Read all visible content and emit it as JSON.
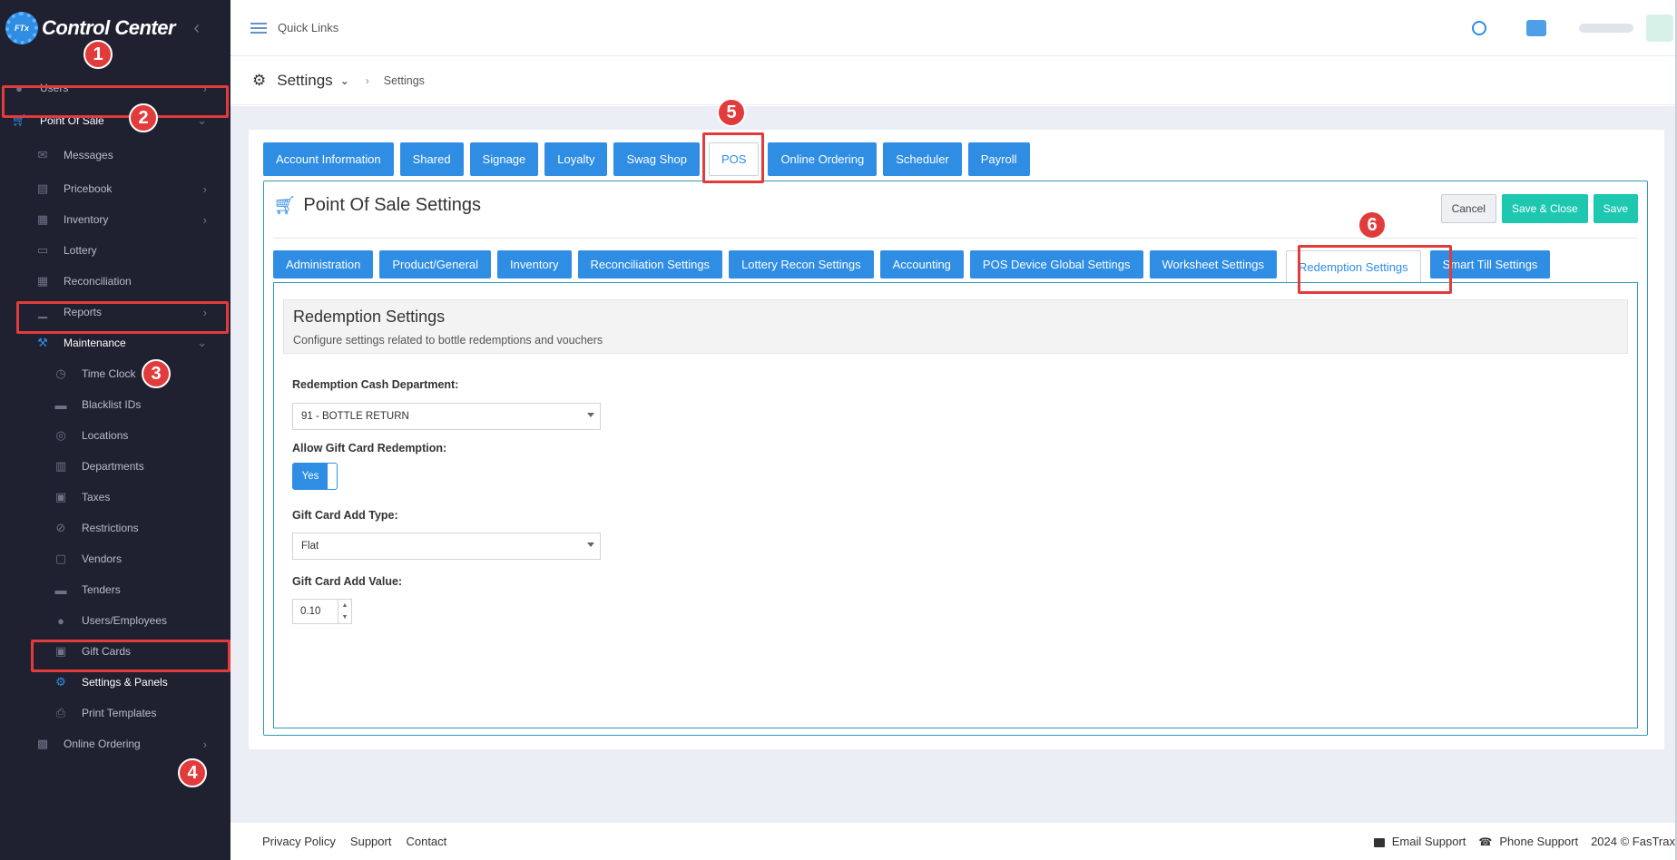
{
  "app": {
    "title": "Control Center",
    "logo_mark": "FTx"
  },
  "sidebar": {
    "items": [
      {
        "label": "Users",
        "icon": "users-icon"
      },
      {
        "label": "Point Of Sale",
        "icon": "cart-icon"
      },
      {
        "label": "Messages",
        "icon": "envelope-icon"
      },
      {
        "label": "Pricebook",
        "icon": "book-icon"
      },
      {
        "label": "Inventory",
        "icon": "warehouse-icon"
      },
      {
        "label": "Lottery",
        "icon": "ticket-icon"
      },
      {
        "label": "Reconciliation",
        "icon": "grid-icon"
      },
      {
        "label": "Reports",
        "icon": "chart-icon"
      },
      {
        "label": "Maintenance",
        "icon": "wrench-icon"
      },
      {
        "label": "Time Clock",
        "icon": "clock-icon"
      },
      {
        "label": "Blacklist IDs",
        "icon": "card-icon"
      },
      {
        "label": "Locations",
        "icon": "pin-icon"
      },
      {
        "label": "Departments",
        "icon": "building-icon"
      },
      {
        "label": "Taxes",
        "icon": "dollar-icon"
      },
      {
        "label": "Restrictions",
        "icon": "ban-icon"
      },
      {
        "label": "Vendors",
        "icon": "truck-icon"
      },
      {
        "label": "Tenders",
        "icon": "money-icon"
      },
      {
        "label": "Users/Employees",
        "icon": "users-icon"
      },
      {
        "label": "Gift Cards",
        "icon": "gift-icon"
      },
      {
        "label": "Settings & Panels",
        "icon": "gear-icon"
      },
      {
        "label": "Print Templates",
        "icon": "printer-icon"
      },
      {
        "label": "Online Ordering",
        "icon": "bag-icon"
      }
    ]
  },
  "annotations": [
    "1",
    "2",
    "3",
    "4",
    "5",
    "6"
  ],
  "topbar": {
    "quick_links": "Quick Links"
  },
  "breadcrumb": {
    "title": "Settings",
    "current": "Settings"
  },
  "top_tabs": [
    "Account Information",
    "Shared",
    "Signage",
    "Loyalty",
    "Swag Shop",
    "POS",
    "Online Ordering",
    "Scheduler",
    "Payroll"
  ],
  "pos_settings": {
    "title": "Point Of Sale Settings",
    "cancel": "Cancel",
    "save_close": "Save & Close",
    "save": "Save",
    "sub_tabs": [
      "Administration",
      "Product/General",
      "Inventory",
      "Reconciliation Settings",
      "Lottery Recon Settings",
      "Accounting",
      "POS Device Global Settings",
      "Worksheet Settings",
      "Redemption Settings",
      "Smart Till Settings"
    ]
  },
  "redemption": {
    "title": "Redemption Settings",
    "description": "Configure settings related to bottle redemptions and vouchers",
    "cash_dept_label": "Redemption Cash Department:",
    "cash_dept_value": "91 - BOTTLE RETURN",
    "gift_card_label": "Allow Gift Card Redemption:",
    "gift_card_value": "Yes",
    "add_type_label": "Gift Card Add Type:",
    "add_type_value": "Flat",
    "add_value_label": "Gift Card Add Value:",
    "add_value": "0.10"
  },
  "footer": {
    "privacy": "Privacy Policy",
    "support": "Support",
    "contact": "Contact",
    "email_support": "Email Support",
    "phone_support": "Phone Support",
    "copyright": "2024 © FasTrax"
  },
  "colors": {
    "primary": "#2f8de4",
    "teal": "#1dc7b0",
    "sidebar": "#1f2131",
    "annotation": "#e23b3b"
  }
}
